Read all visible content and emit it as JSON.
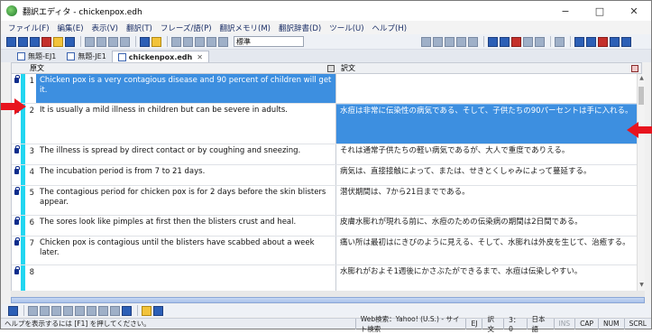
{
  "window": {
    "title": "翻訳エディタ - chickenpox.edh",
    "minimize": "−",
    "maximize": "□",
    "close": "✕"
  },
  "menu": [
    "ファイル(F)",
    "編集(E)",
    "表示(V)",
    "翻訳(T)",
    "フレーズ/語(P)",
    "翻訳メモリ(M)",
    "翻訳辞書(D)",
    "ツール(U)",
    "ヘルプ(H)"
  ],
  "toolbar": {
    "combo_value": "標準"
  },
  "tabs": [
    {
      "label": "無題-EJ1"
    },
    {
      "label": "無題-JE1"
    },
    {
      "label": "chickenpox.edh",
      "close": "✕"
    }
  ],
  "grid": {
    "source_header": "原文",
    "target_header": "訳文",
    "rows": [
      {
        "num": "1",
        "source": "Chicken pox is a very contagious disease and 90 percent of children will get it.",
        "target": ""
      },
      {
        "num": "2",
        "source": "It is usually a mild illness in children but can be severe in adults.",
        "target": "水痘は非常に伝染性の病気である、そして、子供たちの90パーセントは手に入れる。"
      },
      {
        "num": "3",
        "source": "The illness is spread by direct contact or by coughing and sneezing.",
        "target": "それは通常子供たちの軽い病気であるが、大人で重度でありえる。"
      },
      {
        "num": "4",
        "source": "The incubation period is from 7 to 21 days.",
        "target": "病気は、直接接触によって、または、せきとくしゃみによって蔓延する。"
      },
      {
        "num": "5",
        "source": "The contagious period for chicken pox is for 2 days before the skin blisters appear.",
        "target": "潜伏期間は、7から21日までである。"
      },
      {
        "num": "6",
        "source": "The sores look like pimples at first then the blisters crust and heal.",
        "target": "皮膚水膨れが現れる前に、水痘のための伝染病の期間は2日間である。"
      },
      {
        "num": "7",
        "source": "Chicken pox is contagious until the blisters have scabbed about a week later.",
        "target": "痛い所は最初はにきびのように見える、そして、水膨れは外皮を生じて、治癒する。"
      },
      {
        "num": "8",
        "source": "",
        "target": "水膨れがおよそ1週後にかさぶたができるまで、水痘は伝染しやすい。"
      }
    ]
  },
  "status": {
    "hint": "ヘルプを表示するには [F1] を押してください。",
    "web_search": "Web検索：Yahoo! (U.S.) - サイト検索",
    "direction": "EJ",
    "pane": "訳文",
    "position": "3：0",
    "language": "日本語",
    "ins": "INS",
    "caps": "CAP",
    "num": "NUM",
    "scrl": "SCRL"
  },
  "colors": {
    "selection": "#3d8fe0",
    "marker": "#22d6f0",
    "arrow": "#e8141e"
  }
}
